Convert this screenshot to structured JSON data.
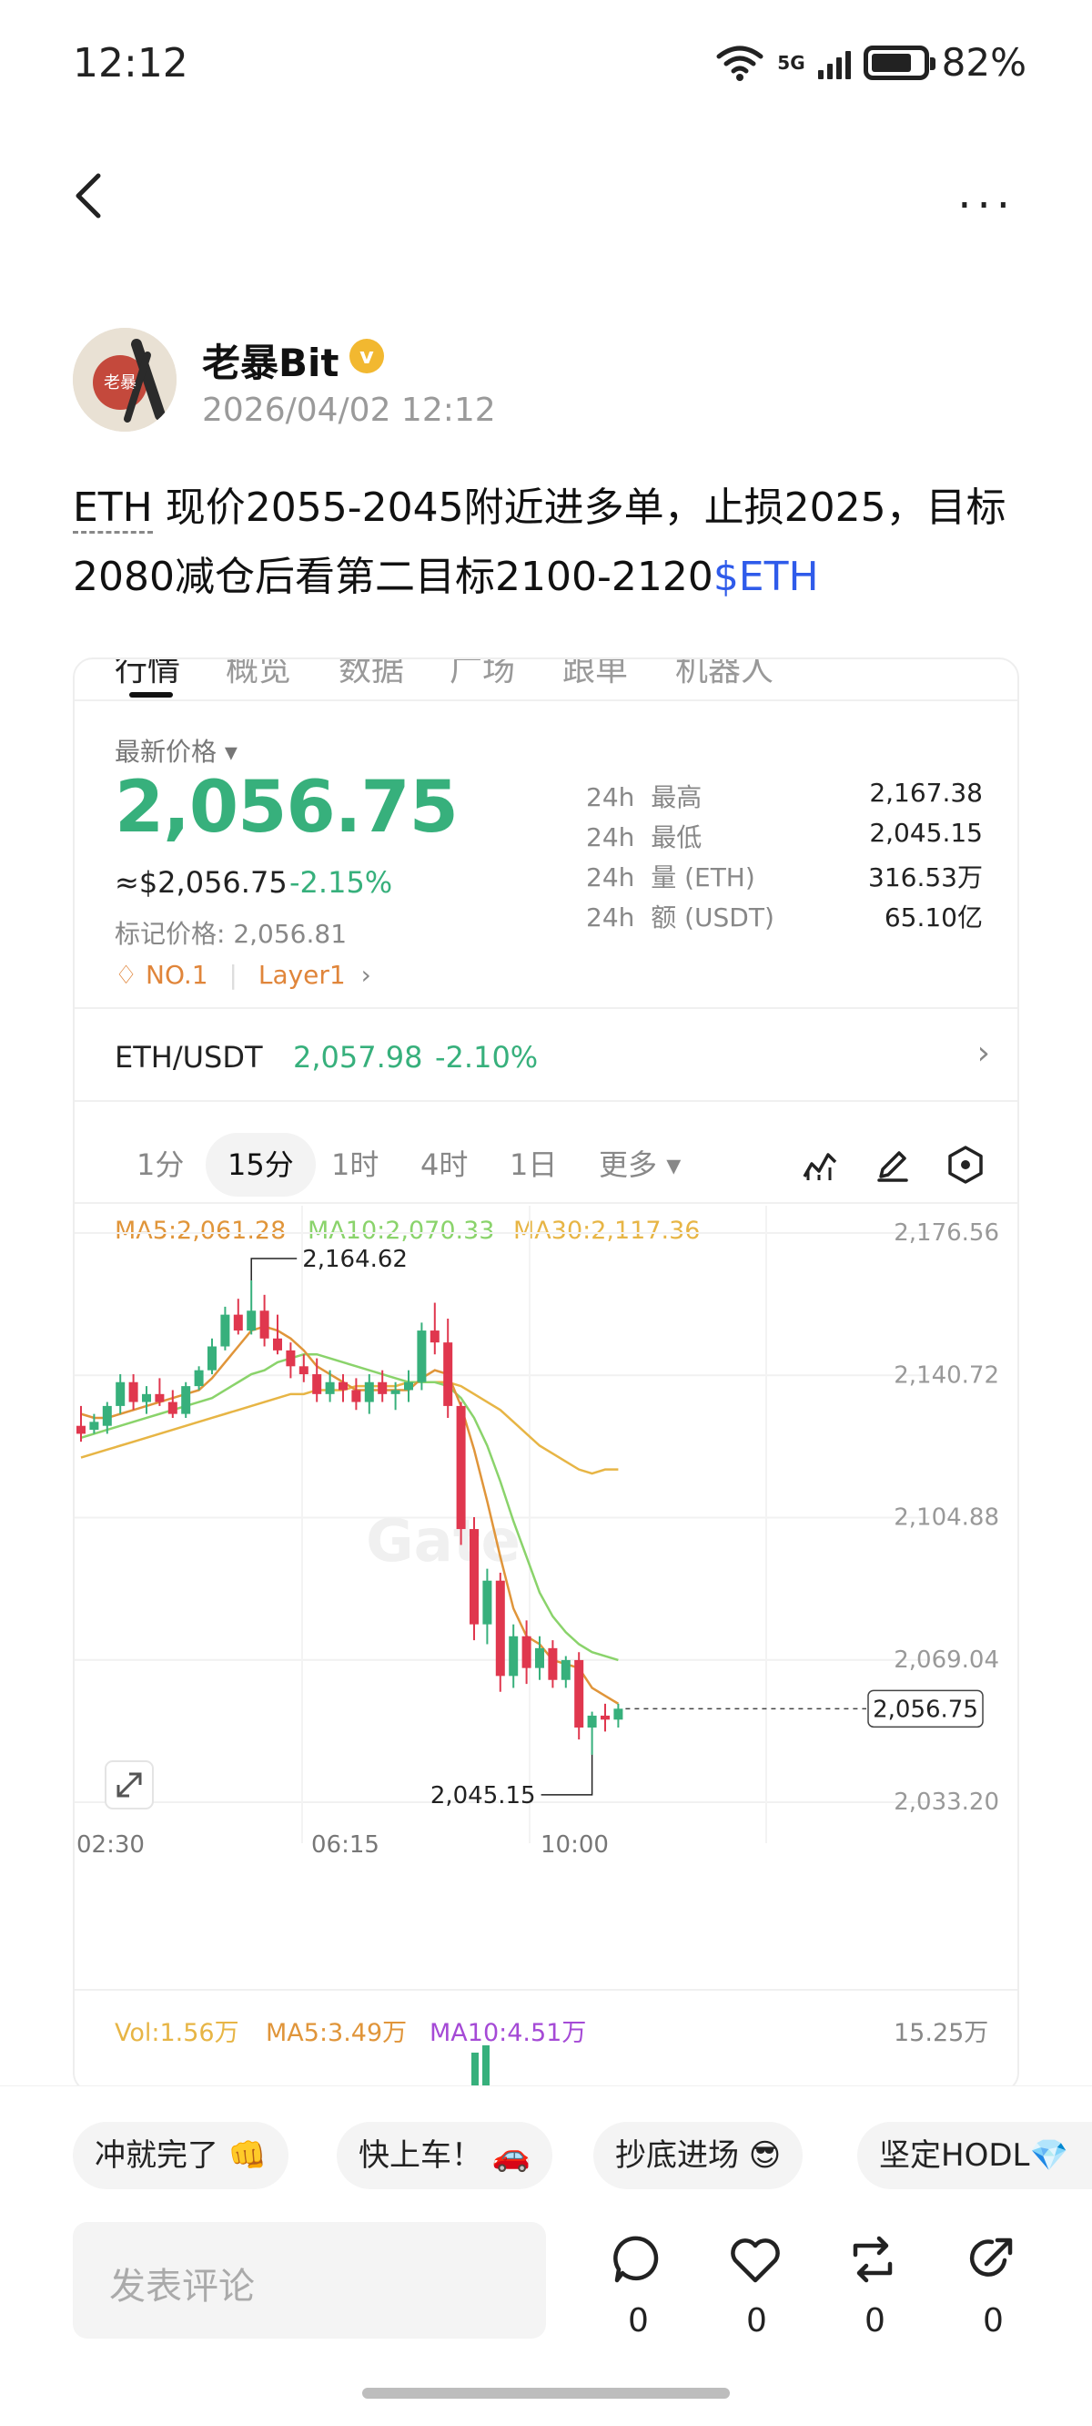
{
  "status_bar": {
    "time": "12:12",
    "signal_small": "6",
    "network": "5G",
    "battery": "82%"
  },
  "nav": {
    "more_label": "···"
  },
  "author": {
    "name": "老暴Bit",
    "verified_mark": "v",
    "time": "2026/04/02 12:12",
    "avatar_text": "老暴"
  },
  "post": {
    "tag": "ETH",
    "text": " 现价2055-2045附近进多单，止损2025，目标2080减仓后看第二目标2100-2120",
    "link": "$ETH"
  },
  "market": {
    "tabs": [
      "行情",
      "概览",
      "数据",
      "广场",
      "跟单",
      "机器人"
    ],
    "latest_label": "最新价格",
    "price": "2,056.75",
    "approx": "≈$2,056.75",
    "change": "-2.15%",
    "mark_price": "标记价格: 2,056.81",
    "rank": "NO.1",
    "category": "Layer1",
    "stats": [
      {
        "period": "24h",
        "label": "最高",
        "value": "2,167.38"
      },
      {
        "period": "24h",
        "label": "最低",
        "value": "2,045.15"
      },
      {
        "period": "24h",
        "label": "量 (ETH)",
        "value": "316.53万"
      },
      {
        "period": "24h",
        "label": "额 (USDT)",
        "value": "65.10亿"
      }
    ],
    "pair": {
      "name": "ETH/USDT",
      "price": "2,057.98",
      "change": "-2.10%"
    },
    "intervals": [
      "1分",
      "15分",
      "1时",
      "4时",
      "1日",
      "更多"
    ],
    "selected_interval": "15分"
  },
  "chart_data": {
    "type": "candlestick",
    "ma_labels": {
      "ma5": "MA5:2,061.28",
      "ma10": "MA10:2,070.33",
      "ma30": "MA30:2,117.36"
    },
    "y_ticks": [
      "2,176.56",
      "2,140.72",
      "2,104.88",
      "2,069.04",
      "2,033.20"
    ],
    "y_range": [
      2033.2,
      2176.56
    ],
    "x_ticks": [
      "02:30",
      "06:15",
      "10:00"
    ],
    "high_label": "2,164.62",
    "low_label": "2,045.15",
    "last_price": "2,056.75",
    "high_value": 2164.62,
    "low_value": 2045.15,
    "last_value": 2056.75,
    "watermark": "Gate",
    "candles": [
      [
        2128,
        2133,
        2124,
        2126
      ],
      [
        2127,
        2131,
        2126,
        2129
      ],
      [
        2128,
        2134,
        2126,
        2133
      ],
      [
        2133,
        2141,
        2131,
        2139
      ],
      [
        2139,
        2141,
        2132,
        2134
      ],
      [
        2134,
        2138,
        2131,
        2136
      ],
      [
        2136,
        2140,
        2133,
        2134
      ],
      [
        2134,
        2137,
        2130,
        2131
      ],
      [
        2131,
        2139,
        2130,
        2138
      ],
      [
        2138,
        2143,
        2137,
        2142
      ],
      [
        2142,
        2150,
        2141,
        2148
      ],
      [
        2148,
        2158,
        2147,
        2156
      ],
      [
        2156,
        2160,
        2151,
        2152
      ],
      [
        2152,
        2164.62,
        2151,
        2157
      ],
      [
        2157,
        2161,
        2148,
        2150
      ],
      [
        2150,
        2156,
        2146,
        2147
      ],
      [
        2147,
        2149,
        2140,
        2143
      ],
      [
        2143,
        2146,
        2139,
        2141
      ],
      [
        2141,
        2145,
        2134,
        2136
      ],
      [
        2136,
        2142,
        2134,
        2139
      ],
      [
        2139,
        2141,
        2134,
        2137
      ],
      [
        2137,
        2140,
        2132,
        2134
      ],
      [
        2134,
        2141,
        2131,
        2139
      ],
      [
        2139,
        2142,
        2134,
        2136
      ],
      [
        2136,
        2139,
        2132,
        2137
      ],
      [
        2137,
        2142,
        2134,
        2139
      ],
      [
        2139,
        2154,
        2137,
        2152
      ],
      [
        2152,
        2159,
        2146,
        2149
      ],
      [
        2149,
        2155,
        2130,
        2133
      ],
      [
        2133,
        2134,
        2098,
        2102
      ],
      [
        2102,
        2105,
        2074,
        2078
      ],
      [
        2078,
        2092,
        2073,
        2089
      ],
      [
        2089,
        2091,
        2061,
        2065
      ],
      [
        2065,
        2078,
        2062,
        2075
      ],
      [
        2075,
        2079,
        2063,
        2067
      ],
      [
        2067,
        2075,
        2064,
        2072
      ],
      [
        2072,
        2074,
        2062,
        2064
      ],
      [
        2064,
        2070,
        2062,
        2069
      ],
      [
        2069,
        2071,
        2049,
        2052
      ],
      [
        2052,
        2056,
        2045.15,
        2055
      ],
      [
        2055,
        2058,
        2051,
        2054
      ],
      [
        2054,
        2058,
        2052,
        2056.75
      ]
    ],
    "ma5": [
      2131,
      2130,
      2130,
      2131,
      2132,
      2133,
      2134,
      2135,
      2136,
      2137,
      2140,
      2144,
      2148,
      2152,
      2153,
      2152,
      2150,
      2147,
      2143,
      2141,
      2139,
      2137,
      2137,
      2137,
      2137,
      2137,
      2140,
      2142,
      2141,
      2133,
      2122,
      2109,
      2095,
      2082,
      2075,
      2073,
      2069,
      2068,
      2067,
      2062,
      2060,
      2058
    ],
    "ma10": [
      2125,
      2126,
      2127,
      2128,
      2129,
      2130,
      2131,
      2132,
      2133,
      2134,
      2135,
      2137,
      2139,
      2141,
      2142,
      2144,
      2145,
      2146,
      2146,
      2145,
      2144,
      2143,
      2142,
      2141,
      2140,
      2139,
      2139,
      2139,
      2138,
      2135,
      2130,
      2123,
      2114,
      2104,
      2095,
      2086,
      2080,
      2076,
      2073,
      2071,
      2070,
      2069
    ],
    "ma30": [
      2120,
      2121,
      2122,
      2123,
      2124,
      2125,
      2126,
      2127,
      2128,
      2129,
      2130,
      2131,
      2132,
      2133,
      2134,
      2135,
      2136,
      2136,
      2137,
      2137,
      2137,
      2138,
      2138,
      2138,
      2138,
      2139,
      2139,
      2139,
      2139,
      2138,
      2136,
      2134,
      2132,
      2129,
      2126,
      2123,
      2121,
      2119,
      2117,
      2116,
      2117,
      2117
    ]
  },
  "volume": {
    "vol": "Vol:1.56万",
    "ma5": "MA5:3.49万",
    "ma10": "MA10:4.51万",
    "axis_label": "15.25万"
  },
  "quick_replies": [
    "冲就完了 👊",
    "快上车！ 🚗",
    "抄底进场 😎",
    "坚定HODL💎"
  ],
  "comment": {
    "placeholder": "发表评论"
  },
  "actions": [
    {
      "icon": "comment-icon",
      "count": "0"
    },
    {
      "icon": "like-icon",
      "count": "0"
    },
    {
      "icon": "repost-icon",
      "count": "0"
    },
    {
      "icon": "share-icon",
      "count": "0"
    }
  ]
}
